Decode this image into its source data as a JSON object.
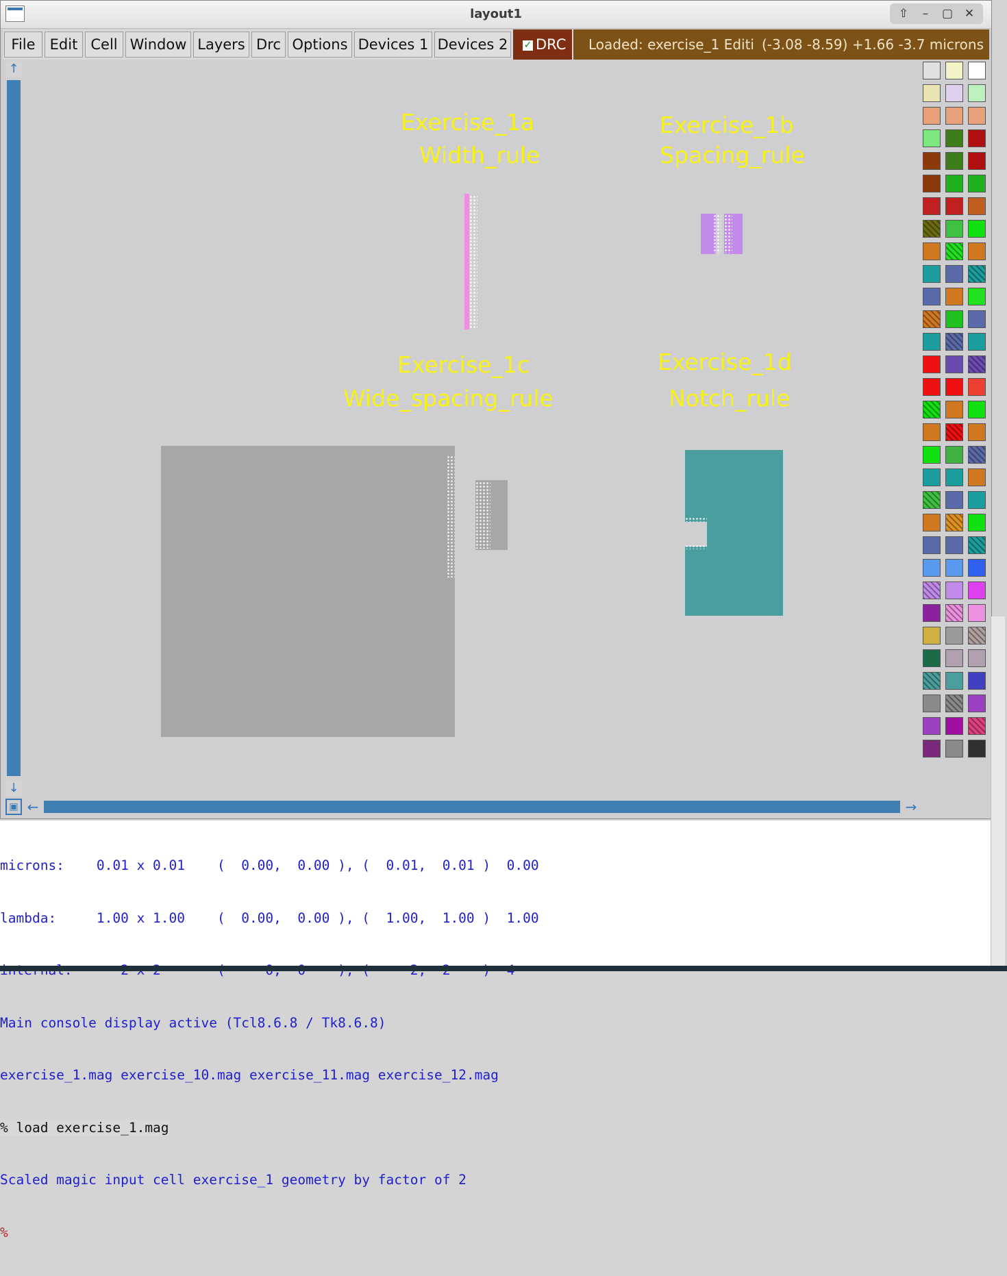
{
  "window": {
    "title": "layout1",
    "wm_buttons": [
      "⇧",
      "–",
      "▢",
      "✕"
    ]
  },
  "menu": [
    {
      "id": "file",
      "label": "File"
    },
    {
      "id": "edit",
      "label": "Edit"
    },
    {
      "id": "cell",
      "label": "Cell"
    },
    {
      "id": "window",
      "label": "Window"
    },
    {
      "id": "layers",
      "label": "Layers"
    },
    {
      "id": "drc",
      "label": "Drc"
    },
    {
      "id": "options",
      "label": "Options"
    },
    {
      "id": "devices1",
      "label": "Devices 1"
    },
    {
      "id": "devices2",
      "label": "Devices 2"
    }
  ],
  "drc_toggle": {
    "label": "DRC",
    "checked": true
  },
  "status": {
    "loaded": "Loaded: exercise_1 Editi",
    "coords": "(-3.08 -8.59) +1.66 -3.7 microns"
  },
  "canvas": {
    "labels": [
      {
        "id": "ex1a-title",
        "text": "Exercise_1a"
      },
      {
        "id": "ex1a-rule",
        "text": "Width_rule"
      },
      {
        "id": "ex1b-title",
        "text": "Exercise_1b"
      },
      {
        "id": "ex1b-rule",
        "text": "Spacing_rule"
      },
      {
        "id": "ex1c-title",
        "text": "Exercise_1c"
      },
      {
        "id": "ex1c-rule",
        "text": "Wide_spacing_rule"
      },
      {
        "id": "ex1d-title",
        "text": "Exercise_1d"
      },
      {
        "id": "ex1d-rule",
        "text": "Notch_rule"
      }
    ],
    "colors": {
      "background": "#cfcfd2",
      "label": "#f6f217",
      "pink_layer": "#ee8fe0",
      "purple_layer": "#c28be9",
      "gray_layer": "#a7a6a9",
      "teal_layer": "#4a9e9d"
    }
  },
  "scrollbars": {
    "vertical_up": "↑",
    "vertical_down": "↓",
    "horizontal_left": "←",
    "horizontal_right": "→",
    "corner": "▣"
  },
  "palette_colors": [
    "#e0e0e0",
    "#f3f3c8",
    "#ffffff",
    "#e8e3b0",
    "#e0d0f0",
    "#bdf0bd",
    "#e8a07a",
    "#e8a07a",
    "#e8a07a",
    "#7de87d",
    "#3d7d1a",
    "#b01010",
    "#8b3a0a",
    "#3d7d1a",
    "#b01010",
    "#8b3a0a",
    "#20b020",
    "#20b020",
    "#c02020",
    "#c02020",
    "#c06020",
    "#6a6a10",
    "#40c040",
    "#10e010",
    "#d07820",
    "#20e020",
    "#d07820",
    "#1a9e9e",
    "#5a6aa8",
    "#1a9e9e",
    "#5a6aa8",
    "#d07820",
    "#20e020",
    "#d07820",
    "#20c020",
    "#5a6aa8",
    "#1a9e9e",
    "#5a6aa8",
    "#1a9e9e",
    "#ee1010",
    "#6a4ab0",
    "#6a4ab0",
    "#ee1010",
    "#ee1010",
    "#ee4030",
    "#10e010",
    "#d07820",
    "#10e010",
    "#d07820",
    "#ee1010",
    "#d07820",
    "#10e010",
    "#40b040",
    "#5a6aa8",
    "#1a9e9e",
    "#1a9e9e",
    "#d07820",
    "#40c040",
    "#5a6aa8",
    "#1a9e9e",
    "#d07820",
    "#e09020",
    "#10e010",
    "#5a6aa8",
    "#5a6aa8",
    "#1a9e9e",
    "#5a9aee",
    "#5a9aee",
    "#3060ee",
    "#c28be9",
    "#c28be9",
    "#dd40ee",
    "#8a20a0",
    "#ee90e0",
    "#ee90e0",
    "#d0b040",
    "#9a9a9a",
    "#b0a0a0",
    "#1a6a4a",
    "#b0a0b0",
    "#b0a0b0",
    "#4a9e9d",
    "#4a9e9d",
    "#4040c0",
    "#8a8a8a",
    "#8a8a8a",
    "#9a40c0",
    "#9a40c0",
    "#a010a0",
    "#e04080",
    "#7a2a7a",
    "#8a8a8a",
    "#303030"
  ],
  "console": {
    "lines": [
      "microns:    0.01 x 0.01    (  0.00,  0.00 ), (  0.01,  0.01 )  0.00",
      "lambda:     1.00 x 1.00    (  0.00,  0.00 ), (  1.00,  1.00 )  1.00",
      "internal:      2 x 2       (     0,  0    ), (     2,  2    )  4",
      "Main console display active (Tcl8.6.8 / Tk8.6.8)",
      "exercise_1.mag exercise_10.mag exercise_11.mag exercise_12.mag"
    ],
    "command": "% load exercise_1.mag",
    "response": "Scaled magic input cell exercise_1 geometry by factor of 2",
    "prompt": "%"
  }
}
